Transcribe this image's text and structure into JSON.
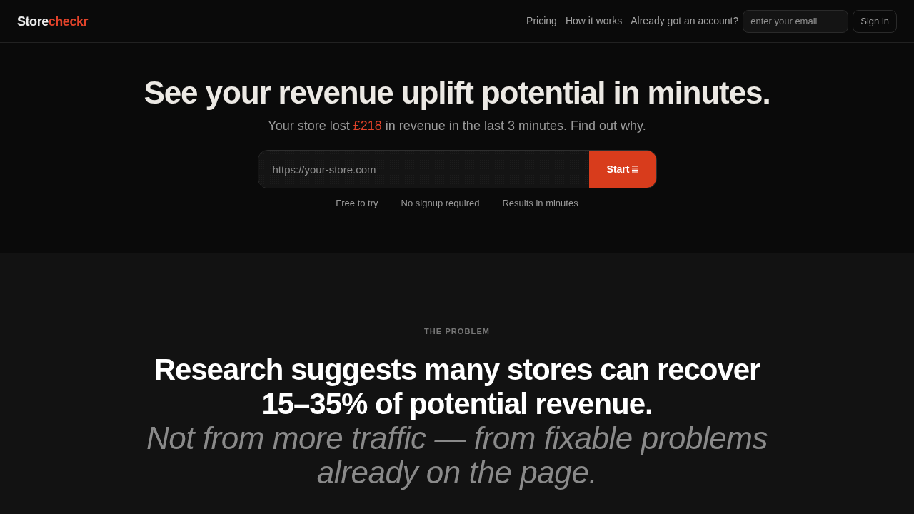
{
  "nav": {
    "logo": {
      "first": "Store",
      "second": "checkr"
    },
    "links": [
      "Pricing",
      "How it works"
    ],
    "account_prompt": "Already got an account?",
    "email_field": {
      "placeholder": "enter your email"
    },
    "sign_in_button": "Sign in"
  },
  "hero": {
    "title": "See your revenue uplift potential in minutes.",
    "subtitle": {
      "before": "Your store lost",
      "amount": "£218",
      "after": "in revenue in the last 3 minutes. Find out why."
    },
    "url_field": {
      "placeholder": "https://your-store.com"
    },
    "start_button": "Start",
    "features": [
      "Free to try",
      "No signup required",
      "Results in minutes"
    ]
  },
  "problem": {
    "eyebrow": "THE PROBLEM",
    "heading": "Research suggests many stores can recover 15–35% of potential revenue.",
    "subheading": "Not from more traffic — from fixable problems already on the page."
  }
}
